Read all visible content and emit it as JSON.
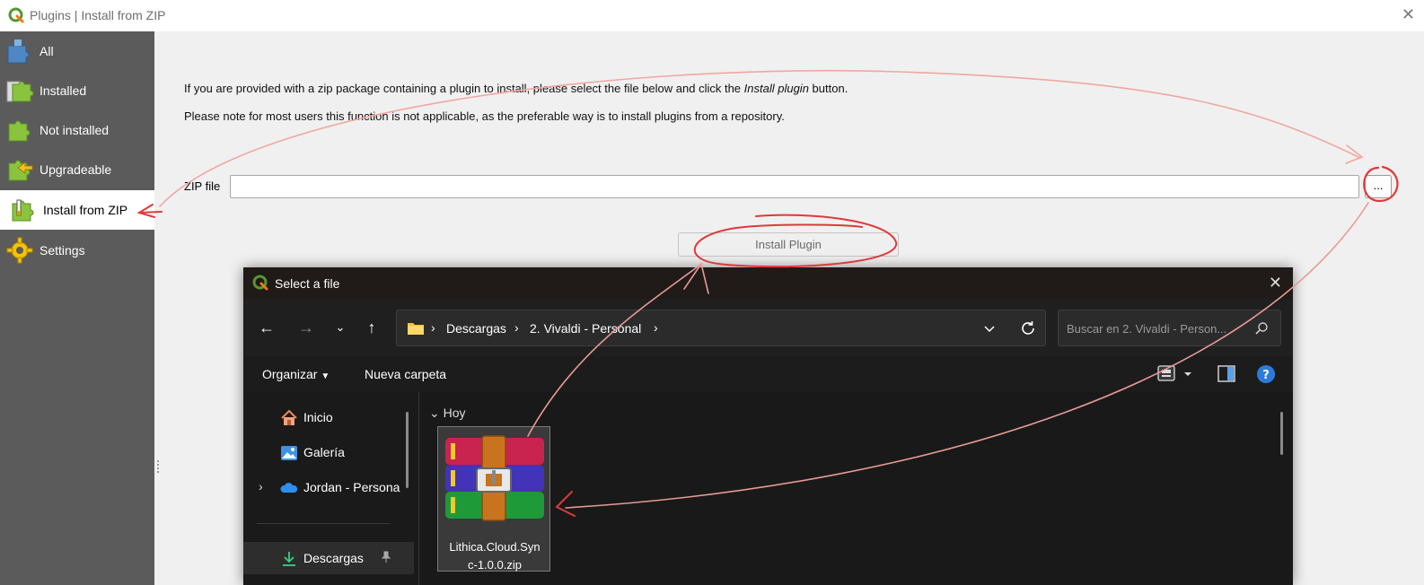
{
  "window": {
    "title": "Plugins | Install from ZIP"
  },
  "sidebar": {
    "items": [
      {
        "label": "All",
        "icon": "puzzle-all-icon"
      },
      {
        "label": "Installed",
        "icon": "puzzle-installed-icon"
      },
      {
        "label": "Not installed",
        "icon": "puzzle-not-installed-icon"
      },
      {
        "label": "Upgradeable",
        "icon": "puzzle-upgrade-icon"
      },
      {
        "label": "Install from ZIP",
        "icon": "puzzle-zip-icon",
        "active": true
      },
      {
        "label": "Settings",
        "icon": "gear-icon"
      }
    ]
  },
  "main": {
    "info_line1_prefix": "If you are provided with a zip package containing a plugin to install, please select the file below and click the ",
    "info_line1_emph": "Install plugin",
    "info_line1_suffix": " button.",
    "info_line2": "Please note for most users this function is not applicable, as the preferable way is to install plugins from a repository.",
    "zip_label": "ZIP file",
    "zip_value": "",
    "browse_label": "...",
    "install_label": "Install Plugin"
  },
  "dialog": {
    "title": "Select a file",
    "breadcrumb": [
      "Descargas",
      "2. Vivaldi - Personal"
    ],
    "search_placeholder": "Buscar en 2. Vivaldi - Person...",
    "toolbar": {
      "organize": "Organizar",
      "new_folder": "Nueva carpeta"
    },
    "nav_items": [
      {
        "label": "Inicio",
        "icon": "home-icon"
      },
      {
        "label": "Galería",
        "icon": "gallery-icon"
      },
      {
        "label": "Jordan - Persona",
        "icon": "onedrive-cloud-icon"
      },
      {
        "label": "Descargas",
        "icon": "download-icon"
      }
    ],
    "group_label": "Hoy",
    "file": {
      "name_line1": "Lithica.Cloud.Syn",
      "name_line2": "c-1.0.0.zip",
      "icon": "winrar-archive-icon"
    }
  },
  "colors": {
    "sidebar_bg": "#5b5b5b",
    "dialog_bg": "#191919",
    "annotation": "#e0393b",
    "qgis_green": "#589632"
  }
}
